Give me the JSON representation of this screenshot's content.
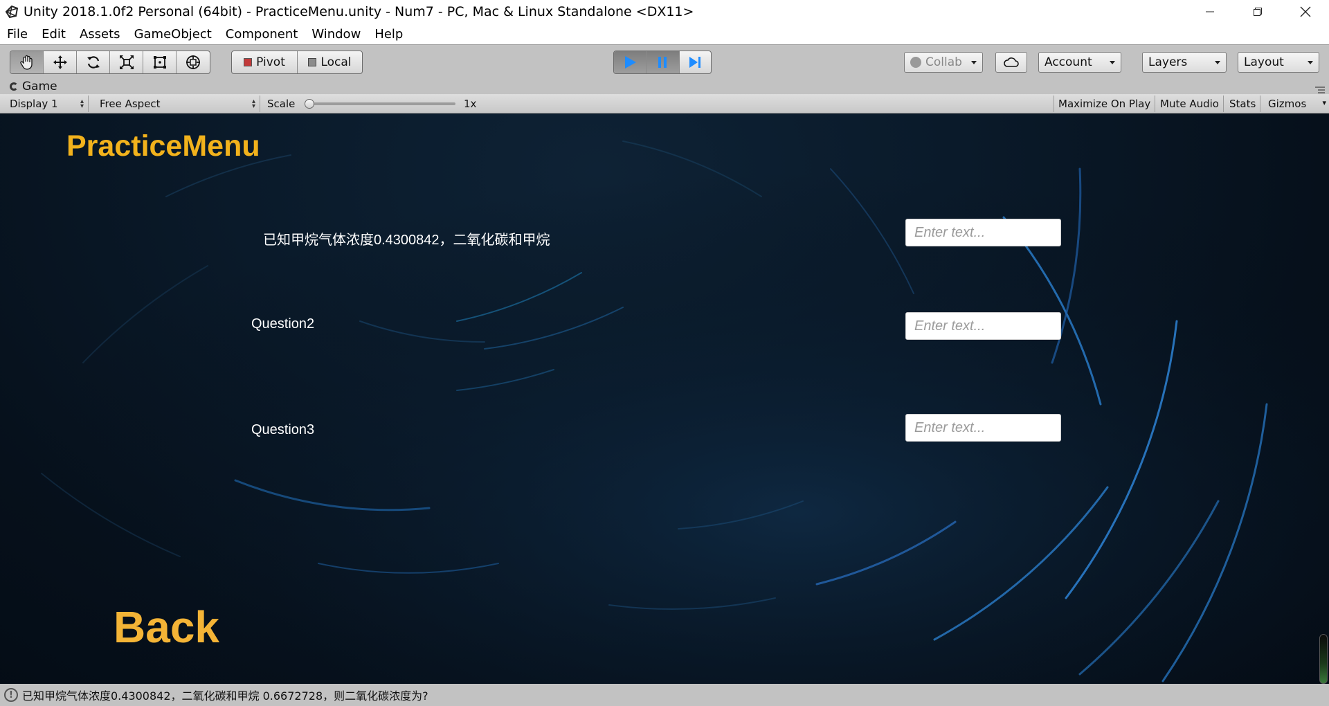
{
  "window": {
    "title": "Unity 2018.1.0f2 Personal (64bit) - PracticeMenu.unity - Num7 - PC, Mac & Linux Standalone <DX11>",
    "icon": "unity-icon",
    "controls": [
      "minimize-icon",
      "restore-icon",
      "close-icon"
    ]
  },
  "menu": [
    "File",
    "Edit",
    "Assets",
    "GameObject",
    "Component",
    "Window",
    "Help"
  ],
  "toolbar": {
    "tools": [
      "hand-icon",
      "move-icon",
      "rotate-icon",
      "scale-icon",
      "rect-icon",
      "transform-icon"
    ],
    "pivot_label": "Pivot",
    "local_label": "Local",
    "play_controls": [
      "play-icon",
      "pause-icon",
      "step-icon"
    ],
    "collab_label": "Collab",
    "account_label": "Account",
    "layers_label": "Layers",
    "layout_label": "Layout"
  },
  "game_tab": {
    "label": "Game"
  },
  "game_bar": {
    "display": "Display 1",
    "aspect": "Free Aspect",
    "scale_label": "Scale",
    "scale_value": "1x",
    "scale_fraction": 0,
    "maximize": "Maximize On Play",
    "mute": "Mute Audio",
    "stats": "Stats",
    "gizmos": "Gizmos"
  },
  "game": {
    "title": "PracticeMenu",
    "questions": [
      {
        "label": "已知甲烷气体浓度0.4300842，二氧化碳和甲烷",
        "placeholder": "Enter text..."
      },
      {
        "label": "Question2",
        "placeholder": "Enter text..."
      },
      {
        "label": "Question3",
        "placeholder": "Enter text..."
      }
    ],
    "back_label": "Back"
  },
  "status": {
    "message": "已知甲烷气体浓度0.4300842，二氧化碳和甲烷 0.6672728，则二氧化碳浓度为?"
  },
  "colors": {
    "game_title": "#f2b21c",
    "back": "#f4b436",
    "play_active": "#1e90ff"
  }
}
